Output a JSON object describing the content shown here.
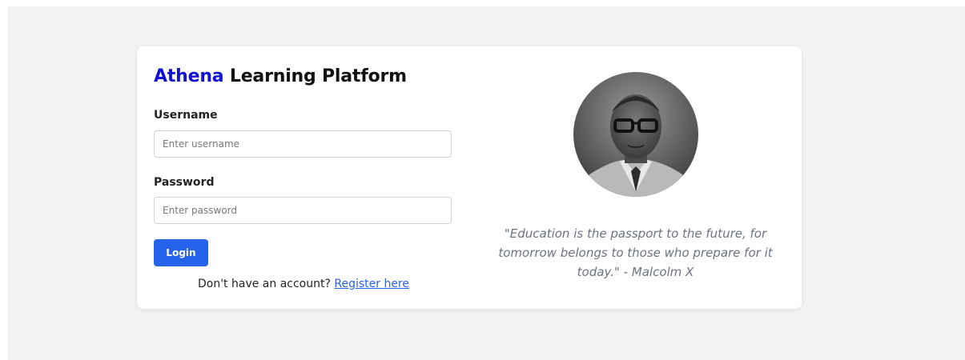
{
  "app": {
    "brand_name": "Athena",
    "title_rest": " Learning Platform"
  },
  "login_form": {
    "username_label": "Username",
    "username_placeholder": "Enter username",
    "username_value": "",
    "password_label": "Password",
    "password_placeholder": "Enter password",
    "password_value": "",
    "login_button_label": "Login",
    "register_prompt": "Don't have an account? ",
    "register_link_label": "Register here"
  },
  "quote_panel": {
    "quote_text": "\"Education is the passport to the future, for tomorrow belongs to those who prepare for it today.\" - Malcolm X"
  },
  "colors": {
    "brand": "#1010d8",
    "accent": "#2563eb",
    "page_background": "#f2f2f2",
    "quote_text": "#6b7280"
  }
}
